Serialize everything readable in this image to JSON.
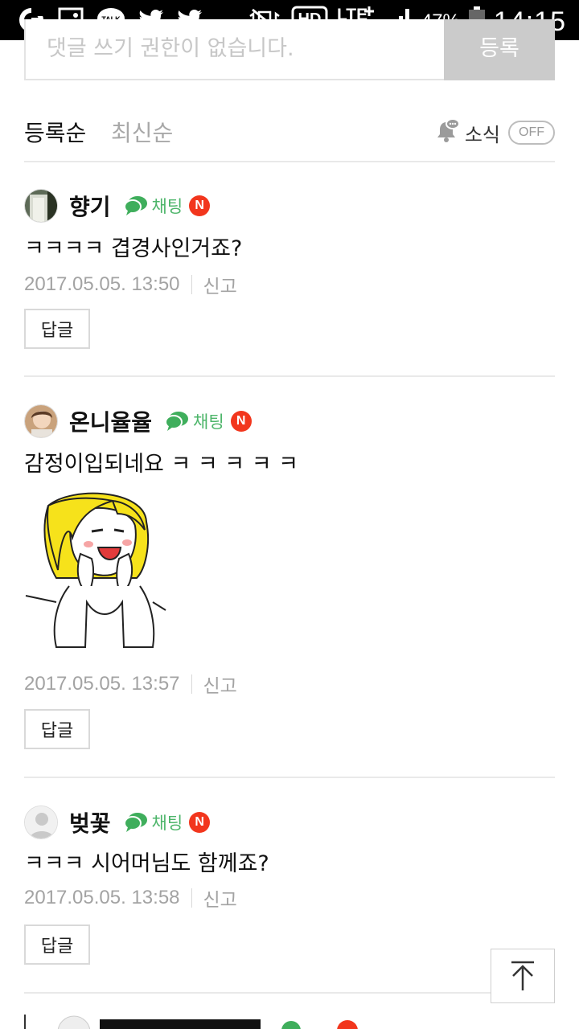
{
  "status_bar": {
    "battery_percent": "47%",
    "time": "14:15",
    "icons": [
      "o-app-icon",
      "gallery-icon",
      "kakaotalk-icon",
      "twitter-icon",
      "twitter-icon",
      "vibrate-muted-icon",
      "hd-voice-icon",
      "lte-plus-icon",
      "signal-icon",
      "battery-icon"
    ],
    "talk_label": "TALK",
    "hd_label": "HD",
    "lte_label": "LTE"
  },
  "comment_input": {
    "placeholder": "댓글 쓰기 권한이 없습니다.",
    "submit_label": "등록"
  },
  "sort": {
    "tabs": [
      {
        "label": "등록순",
        "active": true
      },
      {
        "label": "최신순",
        "active": false
      }
    ],
    "notify_label": "소식",
    "notify_toggle": "OFF"
  },
  "comments": [
    {
      "nickname": "향기",
      "chat_label": "채팅",
      "badge": "N",
      "text": "ㅋㅋㅋㅋ 겹경사인거죠?",
      "date": "2017.05.05. 13:50",
      "report_label": "신고",
      "reply_label": "답글",
      "has_sticker": false
    },
    {
      "nickname": "온니율율",
      "chat_label": "채팅",
      "badge": "N",
      "text": "감정이입되네요 ㅋ ㅋ ㅋ ㅋ ㅋ",
      "date": "2017.05.05. 13:57",
      "report_label": "신고",
      "reply_label": "답글",
      "has_sticker": true
    },
    {
      "nickname": "벚꽃",
      "chat_label": "채팅",
      "badge": "N",
      "text": "ㅋㅋㅋ 시어머님도 함께죠?",
      "date": "2017.05.05. 13:58",
      "report_label": "신고",
      "reply_label": "답글",
      "has_sticker": false
    }
  ],
  "colors": {
    "chat_green": "#4db56a",
    "badge_red": "#f2361d",
    "meta_gray": "#a3a3a3"
  }
}
